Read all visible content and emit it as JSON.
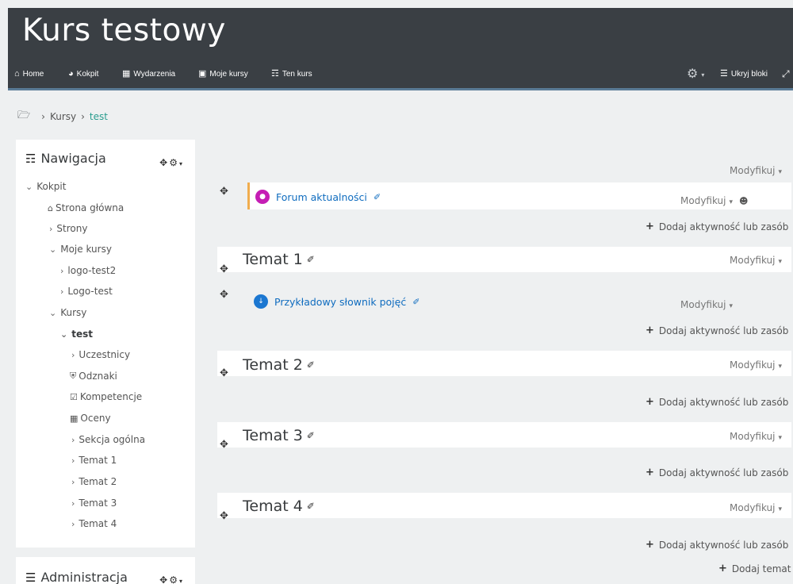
{
  "header": {
    "site_title": "Kurs testowy",
    "nav": [
      {
        "label": "Home",
        "icon": "home-icon"
      },
      {
        "label": "Kokpit",
        "icon": "dashboard-icon"
      },
      {
        "label": "Wydarzenia",
        "icon": "calendar-icon"
      },
      {
        "label": "Moje kursy",
        "icon": "briefcase-icon"
      },
      {
        "label": "Ten kurs",
        "icon": "sitemap-icon"
      }
    ],
    "hide_blocks": "Ukryj bloki",
    "colors": {
      "background": "#3a3f44",
      "accent_line": "#5a7b96"
    }
  },
  "breadcrumb": {
    "items": [
      "Kursy",
      "test"
    ]
  },
  "navigation_block": {
    "title": "Nawigacja",
    "items": [
      {
        "label": "Kokpit",
        "expanded": true
      },
      {
        "label": "Strona główna",
        "icon": "home-icon"
      },
      {
        "label": "Strony",
        "expanded": false
      },
      {
        "label": "Moje kursy",
        "expanded": true
      },
      {
        "label": "logo-test2",
        "expanded": false
      },
      {
        "label": "Logo-test",
        "expanded": false
      },
      {
        "label": "Kursy",
        "expanded": true
      },
      {
        "label": "test",
        "expanded": true,
        "current": true
      },
      {
        "label": "Uczestnicy",
        "expanded": false
      },
      {
        "label": "Odznaki",
        "icon": "shield-icon"
      },
      {
        "label": "Kompetencje",
        "icon": "checkbox-icon"
      },
      {
        "label": "Oceny",
        "icon": "table-icon"
      },
      {
        "label": "Sekcja ogólna",
        "expanded": false
      },
      {
        "label": "Temat 1",
        "expanded": false
      },
      {
        "label": "Temat 2",
        "expanded": false
      },
      {
        "label": "Temat 3",
        "expanded": false
      },
      {
        "label": "Temat 4",
        "expanded": false
      }
    ]
  },
  "admin_block": {
    "title": "Administracja"
  },
  "main": {
    "edit_label": "Modyfikuj",
    "add_activity_label": "Dodaj aktywność lub zasób",
    "add_topic_label": "Dodaj temat",
    "general_activity": {
      "label": "Forum aktualności",
      "icon": "forum-icon",
      "color": "#c51eb4"
    },
    "sections": [
      {
        "title": "Temat 1",
        "activity": {
          "label": "Przykładowy słownik pojęć",
          "icon": "glossary-icon",
          "color": "#1b77d1"
        }
      },
      {
        "title": "Temat 2"
      },
      {
        "title": "Temat 3"
      },
      {
        "title": "Temat 4"
      }
    ]
  }
}
